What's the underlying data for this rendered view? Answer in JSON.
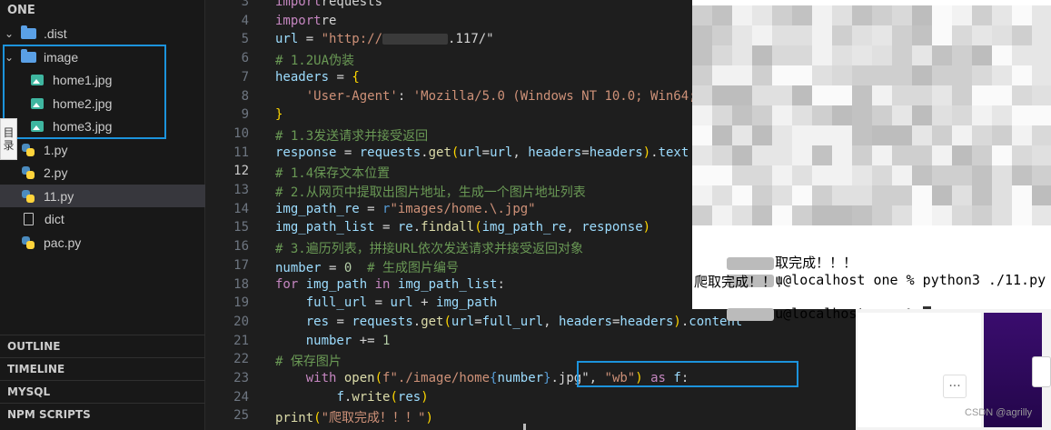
{
  "explorer": {
    "title": "ONE",
    "items": [
      {
        "label": ".dist",
        "type": "folder",
        "expanded": true
      },
      {
        "label": "image",
        "type": "folder",
        "expanded": true
      },
      {
        "label": "home1.jpg",
        "type": "image"
      },
      {
        "label": "home2.jpg",
        "type": "image"
      },
      {
        "label": "home3.jpg",
        "type": "image"
      },
      {
        "label": "1.py",
        "type": "python"
      },
      {
        "label": "2.py",
        "type": "python"
      },
      {
        "label": "11.py",
        "type": "python",
        "selected": true
      },
      {
        "label": "dict",
        "type": "file"
      },
      {
        "label": "pac.py",
        "type": "python"
      }
    ],
    "side_tab": {
      "line1": "目",
      "line2": "录"
    }
  },
  "panels": {
    "outline": "OUTLINE",
    "timeline": "TIMELINE",
    "mysql": "MYSQL",
    "npm": "NPM SCRIPTS"
  },
  "editor": {
    "active_line": "12",
    "lines": [
      {
        "n": "3",
        "t": [
          "import",
          "requests"
        ]
      },
      {
        "n": "4",
        "t": [
          "import",
          "re"
        ]
      },
      {
        "n": "5",
        "t": [
          "url",
          " = ",
          "\"http://",
          ".117/\""
        ]
      },
      {
        "n": "6",
        "t": [
          "# 1.2UA伪装"
        ]
      },
      {
        "n": "7",
        "t": [
          "headers",
          " = ",
          "{"
        ]
      },
      {
        "n": "8",
        "t": [
          "    ",
          "'User-Agent'",
          ": ",
          "'Mozilla/5.0 (Windows NT 10.0; Win64;"
        ]
      },
      {
        "n": "9",
        "t": [
          "}"
        ]
      },
      {
        "n": "10",
        "t": [
          "# 1.3发送请求并接受返回"
        ]
      },
      {
        "n": "11",
        "t": [
          "response",
          " = ",
          "requests",
          ".",
          "get",
          "(",
          "url",
          "=",
          "url",
          ", ",
          "headers",
          "=",
          "headers",
          ")",
          ".",
          "text"
        ]
      },
      {
        "n": "12",
        "t": [
          "# 1.4保存文本位置"
        ]
      },
      {
        "n": "13",
        "t": [
          "# 2.从网页中提取出图片地址，生成一个图片地址列表"
        ]
      },
      {
        "n": "14",
        "t": [
          "img_path_re",
          " = ",
          "r",
          "\"images/home.\\.jpg\""
        ]
      },
      {
        "n": "15",
        "t": [
          "img_path_list",
          " = ",
          "re",
          ".",
          "findall",
          "(",
          "img_path_re",
          ", ",
          "response",
          ")"
        ]
      },
      {
        "n": "16",
        "t": [
          "# 3.遍历列表，拼接URL依次发送请求并接受返回对象"
        ]
      },
      {
        "n": "17",
        "t": [
          "number",
          " = ",
          "0",
          "  ",
          "# 生成图片编号"
        ]
      },
      {
        "n": "18",
        "t": [
          "for",
          " ",
          "img_path",
          " ",
          "in",
          " ",
          "img_path_list",
          ":"
        ]
      },
      {
        "n": "19",
        "t": [
          "    ",
          "full_url",
          " = ",
          "url",
          " + ",
          "img_path"
        ]
      },
      {
        "n": "20",
        "t": [
          "    ",
          "res",
          " = ",
          "requests",
          ".",
          "get",
          "(",
          "url",
          "=",
          "full_url",
          ", ",
          "headers",
          "=",
          "headers",
          ")",
          ".",
          "content"
        ]
      },
      {
        "n": "21",
        "t": [
          "    ",
          "number",
          " += ",
          "1"
        ]
      },
      {
        "n": "22",
        "t": [
          "# 保存图片"
        ]
      },
      {
        "n": "23",
        "t": [
          "    ",
          "with",
          " ",
          "open",
          "(",
          "f\"./image/home",
          "{",
          "number",
          "}",
          ".jpg\"",
          ", ",
          "\"wb\"",
          ")",
          " ",
          "as",
          " ",
          "f",
          ":"
        ]
      },
      {
        "n": "24",
        "t": [
          "        ",
          "f",
          ".",
          "write",
          "(",
          "res",
          ")"
        ]
      },
      {
        "n": "25",
        "t": [
          "print",
          "(",
          "\"爬取完成！！！\"",
          ")"
        ]
      }
    ]
  },
  "terminal": {
    "line_partial": "取完成！！！",
    "line_cmd": "u@localhost one % python3 ./11.py",
    "line_done": "爬取完成！！！",
    "line_prompt": "u@localhost one % "
  },
  "browser": {
    "more_label": "···"
  },
  "watermark": "CSDN @agrilly"
}
